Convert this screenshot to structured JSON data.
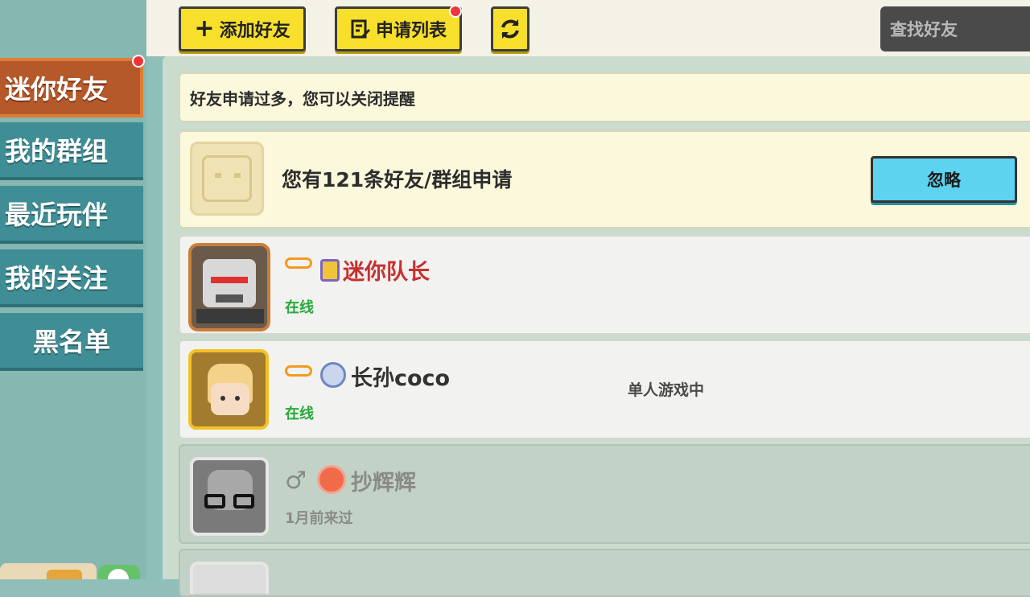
{
  "toolbar": {
    "add_friend_label": "添加好友",
    "request_list_label": "申请列表",
    "search_placeholder": "查找好友"
  },
  "sidebar": {
    "items": [
      {
        "label": "迷你好友",
        "active": true,
        "badge": true
      },
      {
        "label": "我的群组"
      },
      {
        "label": "最近玩伴"
      },
      {
        "label": "我的关注"
      },
      {
        "label": "黑名单"
      }
    ]
  },
  "notice": {
    "text": "好友申请过多，您可以关闭提醒"
  },
  "request_card": {
    "text": "您有121条好友/群组申请",
    "ignore_label": "忽略"
  },
  "friends": [
    {
      "name": "迷你队长",
      "status": "在线",
      "activity": "",
      "name_color": "#c8302f",
      "status_color": "#27a83a",
      "icons": [
        "mask-icon",
        "vip-badge-icon"
      ]
    },
    {
      "name": "长孙coco",
      "status": "在线",
      "activity": "单人游戏中",
      "name_color": "#333333",
      "status_color": "#27a83a",
      "icons": [
        "mask-icon",
        "level-badge-icon"
      ]
    },
    {
      "name": "抄辉辉",
      "status": "1月前来过",
      "activity": "",
      "name_color": "#8a8a8a",
      "status_color": "#8a8a8a",
      "icons": [
        "male-icon",
        "level-badge-icon"
      ]
    },
    {
      "name": "",
      "status": "",
      "activity": ""
    }
  ],
  "colors": {
    "accent_yellow": "#f7df2b",
    "active_tab": "#b5592b",
    "online_green": "#27a83a",
    "ignore_blue": "#5dd3f0"
  }
}
